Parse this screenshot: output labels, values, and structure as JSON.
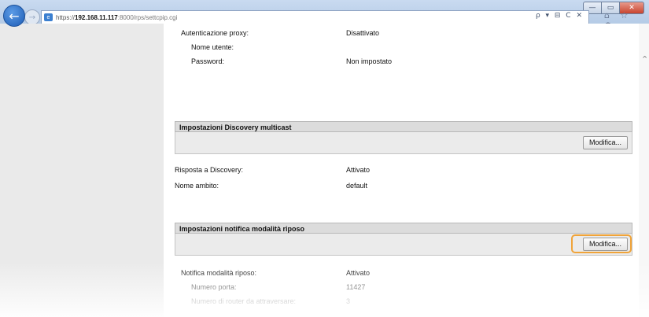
{
  "browser": {
    "back_icon": "←",
    "forward_icon": "→",
    "url_scheme": "https://",
    "url_host": "192.168.11.117",
    "url_path": ":8000/rps/settcpip.cgi",
    "addr_tools": "ρ ▾ ⊟ C ✕",
    "toolbar_icons": "⌂ ☆ ⚙",
    "window_buttons": [
      "—",
      "▭",
      "✕"
    ]
  },
  "proxy": {
    "auth_label": "Autenticazione proxy:",
    "auth_value": "Disattivato",
    "user_label": "Nome utente:",
    "user_value": "",
    "password_label": "Password:",
    "password_value": "Non impostato"
  },
  "discovery": {
    "header": "Impostazioni Discovery multicast",
    "edit_label": "Modifica...",
    "response_label": "Risposta a Discovery:",
    "response_value": "Attivato",
    "scope_label": "Nome ambito:",
    "scope_value": "default"
  },
  "sleep": {
    "header": "Impostazioni notifica modalità riposo",
    "edit_label": "Modifica...",
    "notify_label": "Notifica modalità riposo:",
    "notify_value": "Attivato",
    "port_label": "Numero porta:",
    "port_value": "11427",
    "routers_label": "Numero di router da attraversare:",
    "routers_value": "3"
  }
}
